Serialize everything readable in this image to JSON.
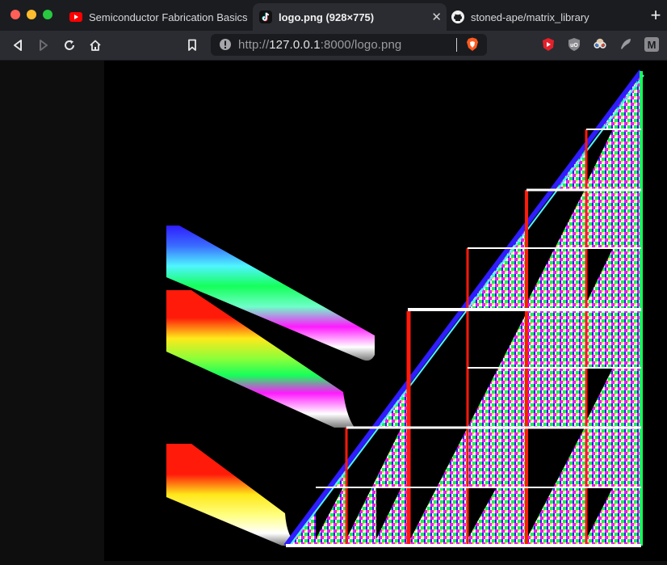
{
  "window": {
    "controls": [
      "close",
      "minimize",
      "maximize"
    ]
  },
  "tabs": [
    {
      "label": "Semiconductor Fabrication Basics -",
      "icon": "youtube-icon",
      "active": false
    },
    {
      "label": "logo.png (928×775)",
      "icon": "tiktok-icon",
      "active": true
    },
    {
      "label": "stoned-ape/matrix_library",
      "icon": "github-icon",
      "active": false
    }
  ],
  "new_tab_label": "+",
  "address": {
    "scheme": "http://",
    "host": "127.0.0.1",
    "rest": ":8000/logo.png"
  },
  "extensions": [
    "youtube-icon",
    "ublock-icon",
    "glasses-icon",
    "feather-icon",
    "m-icon"
  ],
  "extension_m_label": "M",
  "colors": {
    "accent_blue": "#2f1cff",
    "accent_red": "#ff1a0a",
    "accent_yellow": "#ffe81a",
    "accent_green": "#15ff5a",
    "accent_magenta": "#ff1aff",
    "accent_cyan": "#4ff5ff"
  }
}
